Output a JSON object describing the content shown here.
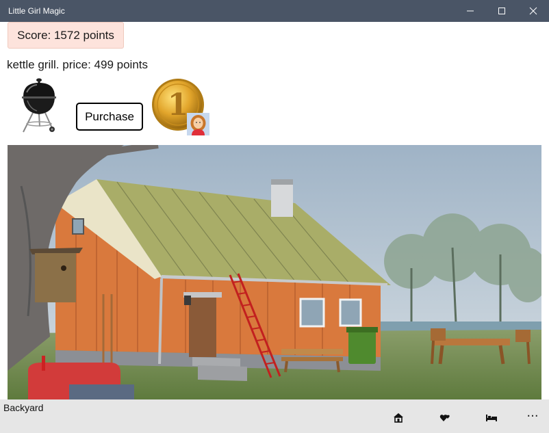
{
  "window": {
    "title": "Little Girl Magic"
  },
  "score": {
    "text": "Score: 1572 points"
  },
  "item": {
    "description": "kettle grill. price: 499 points",
    "icon": "kettle-grill-icon"
  },
  "purchase": {
    "label": "Purchase"
  },
  "coin": {
    "icon": "gold-coin-icon",
    "numeral": "1",
    "avatar": "girl-avatar-icon"
  },
  "scene": {
    "name": "backyard-house-scene"
  },
  "bottombar": {
    "location": "Backyard",
    "more": "···",
    "buttons": [
      "house-icon",
      "hearts-icon",
      "bed-icon"
    ]
  },
  "colors": {
    "titlebar": "#4a5566",
    "score_bg": "#fde3dc",
    "bottombar": "#e6e6e6"
  }
}
